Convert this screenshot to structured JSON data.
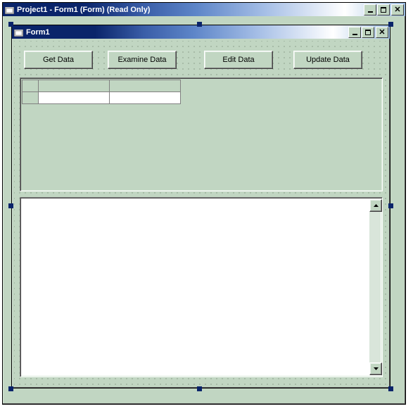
{
  "outer_window": {
    "title": "Project1 - Form1 (Form)  (Read Only)"
  },
  "form1": {
    "title": "Form1"
  },
  "buttons": {
    "get": "Get Data",
    "examine": "Examine Data",
    "edit": "Edit Data",
    "update": "Update Data"
  },
  "grid": {
    "rows": 2,
    "cols": 3
  }
}
